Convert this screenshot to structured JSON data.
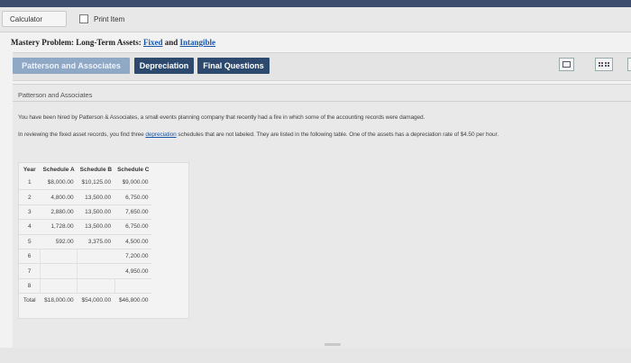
{
  "toolbar": {
    "calculator_label": "Calculator",
    "print_label": "Print Item"
  },
  "problem": {
    "title_prefix": "Mastery Problem: Long-Term Assets: ",
    "title_link1": "Fixed",
    "title_and": " and ",
    "title_link2": "Intangible"
  },
  "tabs": [
    {
      "label": "Patterson and Associates"
    },
    {
      "label": "Depreciation"
    },
    {
      "label": "Final Questions"
    }
  ],
  "panel": {
    "title": "Patterson and Associates",
    "para1": "You have been hired by Patterson & Associates, a small events planning company that recently had a fire in which some of the accounting records were damaged.",
    "para2_before": "In reviewing the fixed asset records, you find three ",
    "para2_link": "depreciation",
    "para2_after": " schedules that are not labeled. They are listed in the following table. One of the assets has a depreciation rate of $4.50 per hour."
  },
  "schedule_table": {
    "headers": [
      "Year",
      "Schedule A",
      "Schedule B",
      "Schedule C"
    ],
    "rows": [
      [
        "1",
        "$8,000.00",
        "$10,125.00",
        "$9,000.00"
      ],
      [
        "2",
        "4,800.00",
        "13,500.00",
        "6,750.00"
      ],
      [
        "3",
        "2,880.00",
        "13,500.00",
        "7,650.00"
      ],
      [
        "4",
        "1,728.00",
        "13,500.00",
        "6,750.00"
      ],
      [
        "5",
        "592.00",
        "3,375.00",
        "4,500.00"
      ],
      [
        "6",
        "",
        "",
        "7,200.00"
      ],
      [
        "7",
        "",
        "",
        "4,950.00"
      ],
      [
        "8",
        "",
        "",
        ""
      ]
    ],
    "total": [
      "Total",
      "$18,000.00",
      "$54,000.00",
      "$46,800.00"
    ]
  }
}
